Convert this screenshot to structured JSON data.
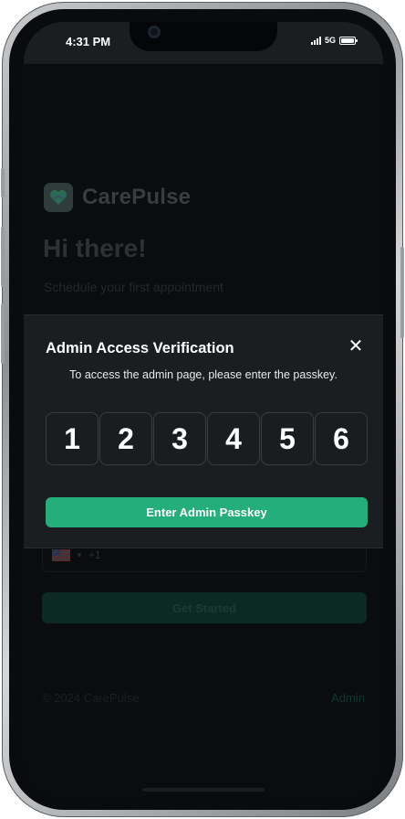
{
  "status_bar": {
    "time": "4:31 PM",
    "network": "5G"
  },
  "app": {
    "brand": "CarePulse"
  },
  "hero": {
    "title": "Hi there!",
    "subtitle": "Schedule your first appointment"
  },
  "phone_input": {
    "country_code": "+1"
  },
  "form": {
    "submit_label": "Get Started"
  },
  "footer": {
    "copyright": "© 2024 CarePulse",
    "admin_link": "Admin"
  },
  "modal": {
    "title": "Admin Access Verification",
    "description": "To access the admin page, please enter the passkey.",
    "close_icon": "close-icon",
    "passkey_digits": [
      "1",
      "2",
      "3",
      "4",
      "5",
      "6"
    ],
    "submit_label": "Enter Admin Passkey"
  },
  "colors": {
    "accent": "#24ae7c",
    "modal_bg": "#1b1e21",
    "screen_bg": "#050607"
  }
}
